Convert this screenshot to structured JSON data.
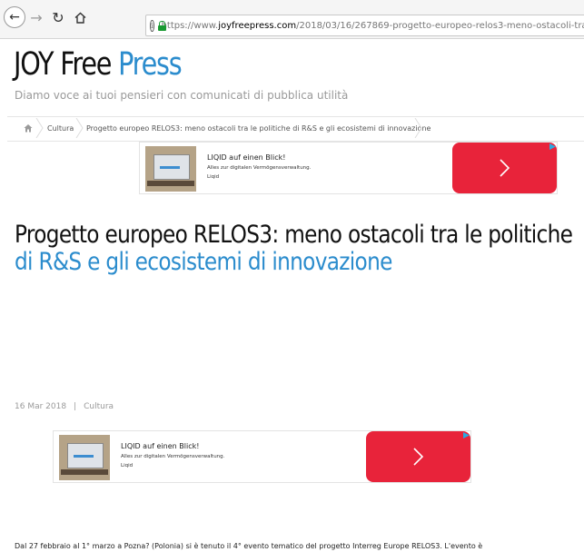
{
  "browser": {
    "url_scheme": "https://www.",
    "url_domain": "joyfreepress.com",
    "url_path": "/2018/03/16/267869-progetto-europeo-relos3-meno-ostacoli-tra-le-politiche-di-rs-e-gli-ec"
  },
  "site": {
    "title_main": "JOY Free",
    "title_accent": "Press",
    "tagline": "Diamo voce ai tuoi pensieri con comunicati di pubblica utilità",
    "accent_color": "#2b8ccd"
  },
  "breadcrumb": {
    "items": [
      "Cultura",
      "Progetto europeo RELOS3: meno ostacoli tra le politiche di R&S e gli ecosistemi di innovazione"
    ]
  },
  "ads": {
    "title": "LIQID auf einen Blick!",
    "subtitle": "Alles zur digitalen Vermögensverwaltung.",
    "brand": "Liqid",
    "cta_color": "#e8233a"
  },
  "article": {
    "headline_line1": "Progetto europeo RELOS3: meno ostacoli tra le politiche",
    "headline_line2": "di R&S e gli ecosistemi di innovazione",
    "date": "16 Mar 2018",
    "separator": "|",
    "category": "Cultura",
    "body_first_line": "Dal 27 febbraio al 1° marzo a Pozna? (Polonia) si è tenuto il 4° evento tematico del progetto Interreg Europe RELOS3. L'evento è"
  }
}
